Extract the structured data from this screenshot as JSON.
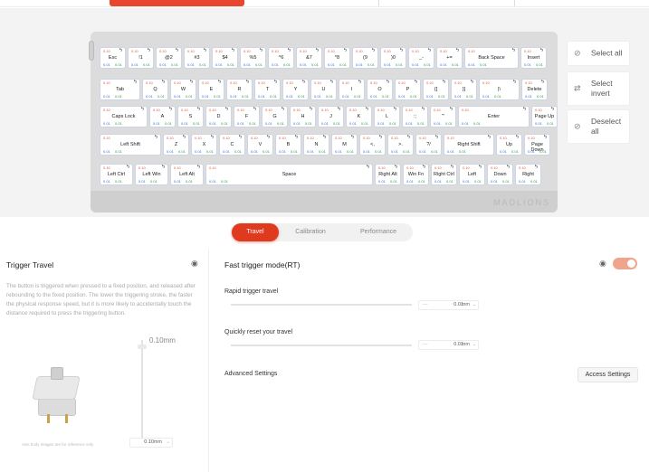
{
  "keyboard": {
    "brand": "MADLIONS",
    "default_travel": "0.10",
    "default_actuation": "0.01",
    "rows": [
      [
        "Esc",
        "!1",
        "@2",
        "#3",
        "$4",
        "%5",
        "^6",
        "&7",
        "*8",
        "(9",
        ")0",
        "_-",
        "+=",
        "Back Space",
        "Insert"
      ],
      [
        "Tab",
        "Q",
        "W",
        "E",
        "R",
        "T",
        "Y",
        "U",
        "I",
        "O",
        "P",
        "{[",
        "}]",
        "|\\",
        "Delete"
      ],
      [
        "Caps Lock",
        "A",
        "S",
        "D",
        "F",
        "G",
        "H",
        "J",
        "K",
        "L",
        ":;",
        "\"'",
        "Enter",
        "Page Up"
      ],
      [
        "Left Shift",
        "Z",
        "X",
        "C",
        "V",
        "B",
        "N",
        "M",
        "<,",
        ">.",
        "?/",
        "Right Shift",
        "Up",
        "Page Down"
      ],
      [
        "Left Ctrl",
        "Left Win",
        "Left Alt",
        "Space",
        "Right Alt",
        "Win Fn",
        "Right Ctrl",
        "Left",
        "Down",
        "Right"
      ]
    ]
  },
  "side_actions": [
    {
      "label": "Select all",
      "icon": "check-circle-icon"
    },
    {
      "label": "Select invert",
      "icon": "swap-icon"
    },
    {
      "label": "Deselect all",
      "icon": "cancel-circle-icon"
    }
  ],
  "tabs": [
    {
      "label": "Travel",
      "active": true
    },
    {
      "label": "Calibration",
      "active": false
    },
    {
      "label": "Performance",
      "active": false
    }
  ],
  "trigger": {
    "title": "Trigger Travel",
    "description": "The button is triggered when pressed to a fixed position, and released after rebounding to the fixed position. The lower the triggering stroke, the faster the physical response speed, but it is more likely to accidentally touch the distance required to press the triggering button.",
    "top_value": "0.10mm",
    "value": "0.10",
    "unit": "mm",
    "note": "Axis body images are for reference only"
  },
  "rt": {
    "title": "Fast trigger mode(RT)",
    "enabled": true,
    "rapid_label": "Rapid trigger travel",
    "rapid_value": "0.01",
    "reset_label": "Quickly reset your travel",
    "reset_value": "0.01",
    "unit": "mm",
    "advanced_label": "Advanced Settings",
    "access_button": "Access Settings"
  }
}
